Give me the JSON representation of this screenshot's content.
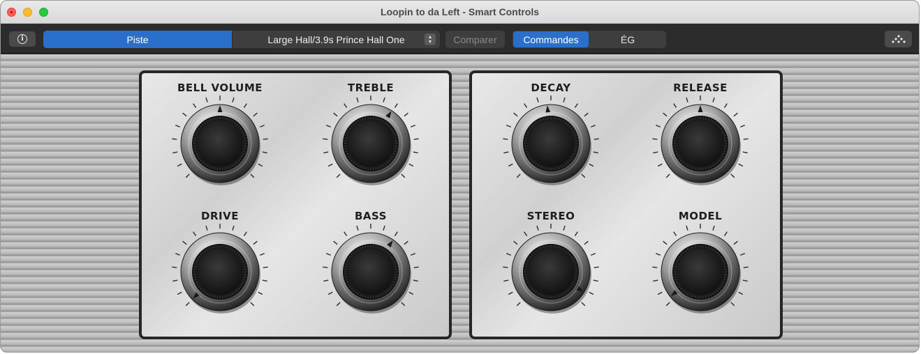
{
  "window": {
    "title": "Loopin to da Left - Smart Controls"
  },
  "toolbar": {
    "info_icon": "info-icon",
    "track_label": "Piste",
    "preset_name": "Large Hall/3.9s Prince Hall One",
    "compare_label": "Comparer",
    "controls_label": "Commandes",
    "eq_label": "ÉG",
    "automation_icon": "automation-icon"
  },
  "colors": {
    "accent": "#2a6fc9",
    "toolbar_bg": "#2c2c2c",
    "panel_border": "#262626"
  },
  "panels": [
    {
      "knobs": [
        {
          "label": "BELL VOLUME",
          "value": 0.5
        },
        {
          "label": "TREBLE",
          "value": 0.62
        },
        {
          "label": "DRIVE",
          "value": 0.0
        },
        {
          "label": "BASS",
          "value": 0.63
        }
      ]
    },
    {
      "knobs": [
        {
          "label": "DECAY",
          "value": 0.48
        },
        {
          "label": "RELEASE",
          "value": 0.5
        },
        {
          "label": "STEREO",
          "value": 0.95
        },
        {
          "label": "MODEL",
          "value": 0.02
        }
      ]
    }
  ]
}
